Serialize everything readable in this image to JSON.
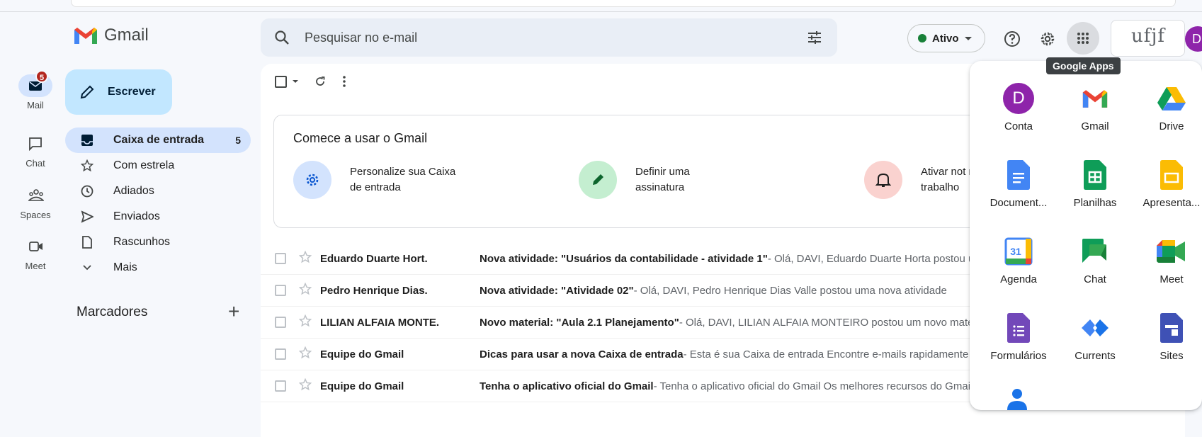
{
  "header": {
    "logo_text": "Gmail",
    "search_placeholder": "Pesquisar no e-mail",
    "status_label": "Ativo",
    "org_logo_text": "ufjf",
    "avatar_letter": "D",
    "apps_tooltip": "Google Apps"
  },
  "rail": {
    "mail": {
      "label": "Mail",
      "badge": "5"
    },
    "chat": {
      "label": "Chat"
    },
    "spaces": {
      "label": "Spaces"
    },
    "meet": {
      "label": "Meet"
    }
  },
  "compose": {
    "label": "Escrever"
  },
  "nav": {
    "items": [
      {
        "label": "Caixa de entrada",
        "count": "5",
        "icon": "inbox-icon"
      },
      {
        "label": "Com estrela",
        "icon": "star-icon"
      },
      {
        "label": "Adiados",
        "icon": "clock-icon"
      },
      {
        "label": "Enviados",
        "icon": "send-icon"
      },
      {
        "label": "Rascunhos",
        "icon": "draft-icon"
      },
      {
        "label": "Mais",
        "icon": "chevron-down-icon"
      }
    ],
    "labels_heading": "Marcadores"
  },
  "onboarding": {
    "title": "Comece a usar o Gmail",
    "cards": [
      {
        "text": "Personalize sua Caixa de entrada",
        "icon": "settings-icon"
      },
      {
        "text": "Definir uma assinatura",
        "icon": "pen-icon"
      },
      {
        "text": "Ativar not na área d trabalho",
        "icon": "bell-icon"
      }
    ]
  },
  "emails": [
    {
      "sender": "Eduardo Duarte Hort.",
      "subject": "Nova atividade: \"Usuários da contabilidade - atividade 1\"",
      "snippet": " - Olá, DAVI, Eduardo Duarte Horta postou uma nova atividade"
    },
    {
      "sender": "Pedro Henrique Dias.",
      "subject": "Nova atividade: \"Atividade 02\"",
      "snippet": " - Olá, DAVI, Pedro Henrique Dias Valle postou uma nova atividade"
    },
    {
      "sender": "LILIAN ALFAIA MONTE.",
      "subject": "Novo material: \"Aula 2.1 Planejamento\"",
      "snippet": " - Olá, DAVI, LILIAN ALFAIA MONTEIRO postou um novo material"
    },
    {
      "sender": "Equipe do Gmail",
      "subject": "Dicas para usar a nova Caixa de entrada",
      "snippet": " - Esta é sua Caixa de entrada Encontre e-mails rapidamente"
    },
    {
      "sender": "Equipe do Gmail",
      "subject": "Tenha o aplicativo oficial do Gmail",
      "snippet": " - Tenha o aplicativo oficial do Gmail Os melhores recursos do Gmail"
    }
  ],
  "apps": [
    {
      "label": "Conta",
      "icon": "account-avatar-icon"
    },
    {
      "label": "Gmail",
      "icon": "gmail-icon"
    },
    {
      "label": "Drive",
      "icon": "drive-icon"
    },
    {
      "label": "Document...",
      "icon": "docs-icon"
    },
    {
      "label": "Planilhas",
      "icon": "sheets-icon"
    },
    {
      "label": "Apresenta...",
      "icon": "slides-icon"
    },
    {
      "label": "Agenda",
      "icon": "calendar-icon",
      "day": "31"
    },
    {
      "label": "Chat",
      "icon": "chat-app-icon"
    },
    {
      "label": "Meet",
      "icon": "meet-app-icon"
    },
    {
      "label": "Formulários",
      "icon": "forms-icon"
    },
    {
      "label": "Currents",
      "icon": "currents-icon"
    },
    {
      "label": "Sites",
      "icon": "sites-icon"
    }
  ],
  "colors": {
    "background": "#f6f8fc",
    "accent": "#d3e3fd",
    "compose": "#c2e7ff",
    "badge": "#b3261e",
    "status_green": "#188038",
    "avatar": "#8e24aa"
  }
}
